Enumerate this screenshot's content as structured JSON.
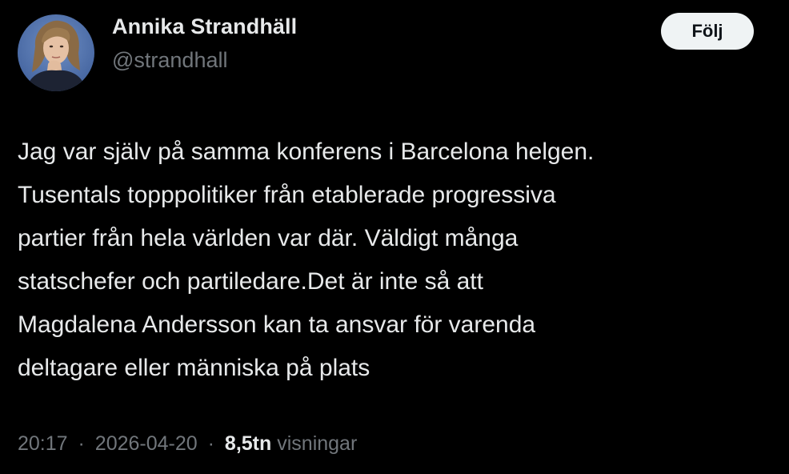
{
  "author": {
    "name": "Annika Strandhäll",
    "handle": "@strandhall"
  },
  "follow_button": {
    "label": "Följ"
  },
  "tweet": {
    "lines": [
      "Jag var själv på samma konferens i Barcelona helgen.",
      "Tusentals topppolitiker från etablerade progressiva",
      "partier från hela världen var där. Väldigt många",
      "statschefer och partiledare.Det är inte så att",
      "Magdalena Andersson kan ta ansvar för varenda",
      "deltagare eller människa på plats"
    ]
  },
  "meta": {
    "time": "20:17",
    "separator": "·",
    "date": "2026-04-20",
    "views_count": "8,5tn",
    "views_label": "visningar"
  },
  "colors": {
    "background": "#000000",
    "text_primary": "#e7e9ea",
    "text_secondary": "#71767b",
    "follow_bg": "#eff3f4"
  }
}
